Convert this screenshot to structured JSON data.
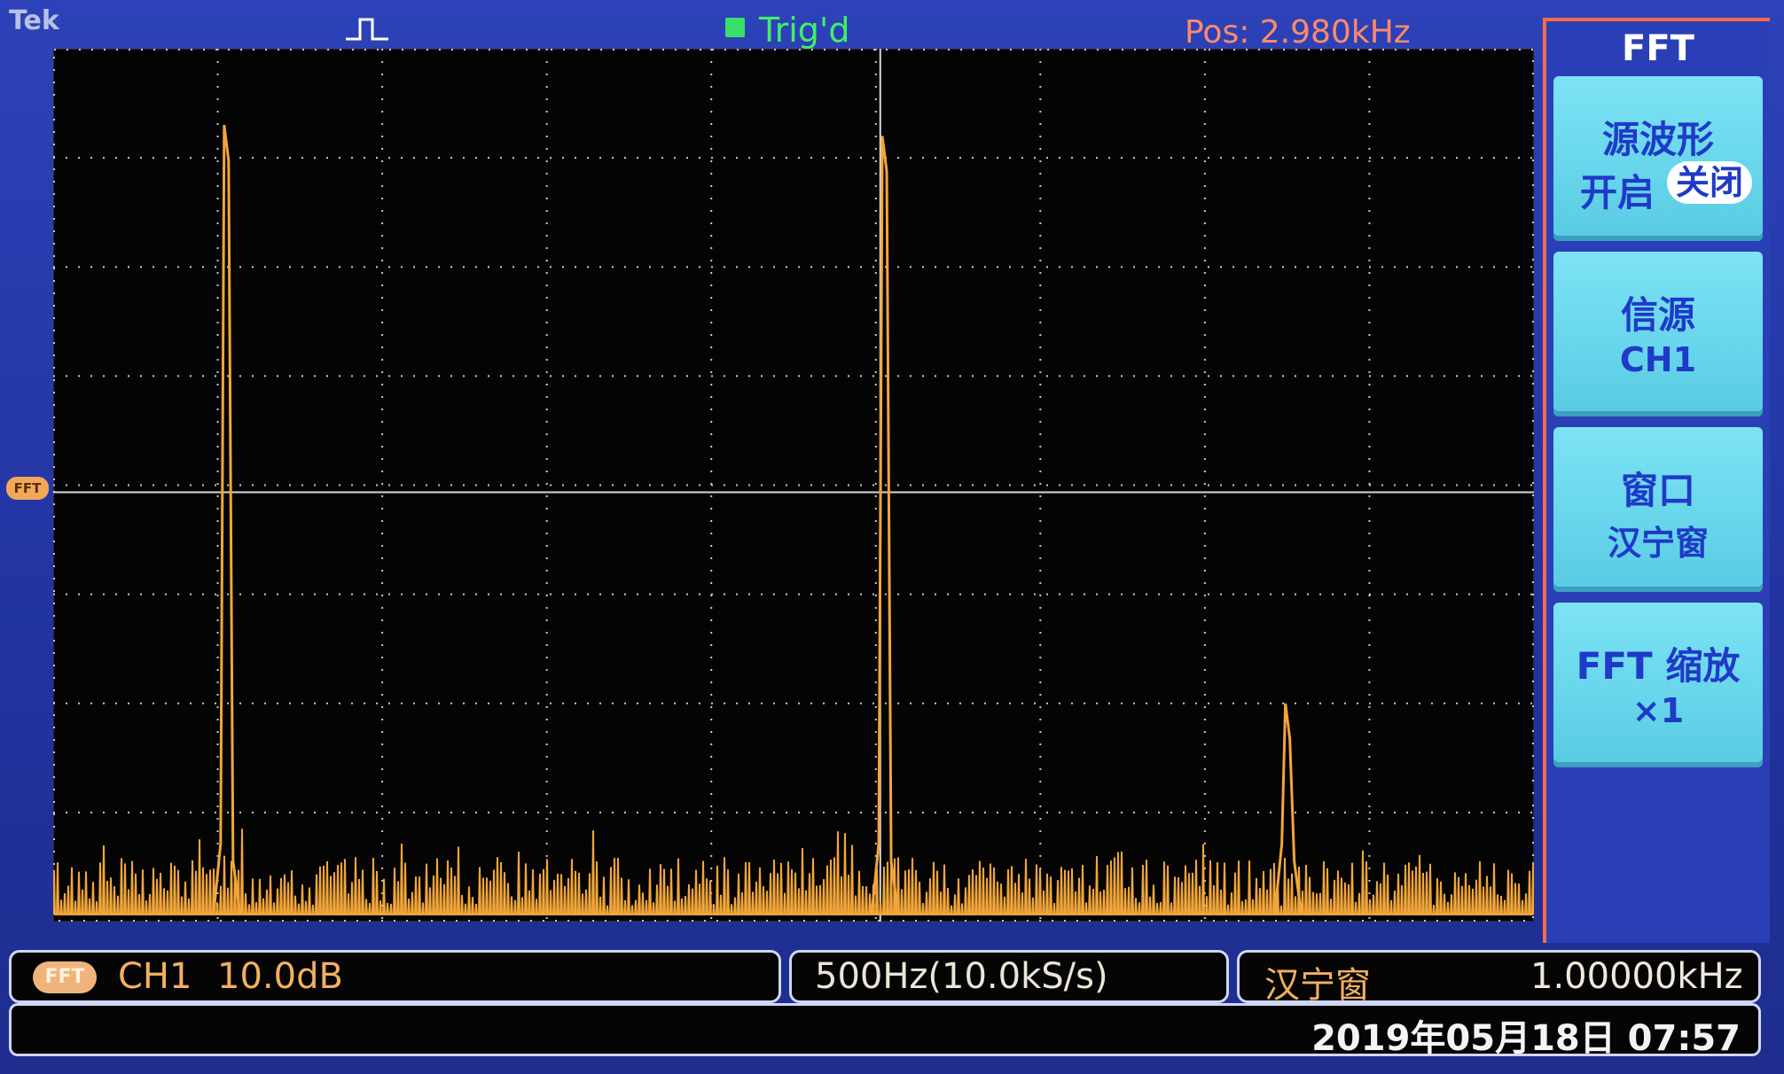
{
  "top": {
    "brand": "Tek",
    "trigger_status": "Trig'd",
    "position": "Pos: 2.980kHz"
  },
  "markers": {
    "fft_level": "FFT"
  },
  "menu": {
    "title": "FFT",
    "items": [
      {
        "line1": "源波形",
        "on_label": "开启",
        "off_label": "关闭",
        "selected": "关闭"
      },
      {
        "line1": "信源",
        "line2": "CH1"
      },
      {
        "line1": "窗口",
        "line2": "汉宁窗"
      },
      {
        "line1": "FFT 缩放",
        "line2": "×1"
      }
    ]
  },
  "status": {
    "channel_badge": "FFT",
    "channel": "CH1",
    "scale": "10.0dB",
    "timebase": "500Hz(10.0kS/s)",
    "window": "汉宁窗",
    "frequency": "1.00000kHz"
  },
  "datetime": "2019年05月18日 07:57",
  "colors": {
    "trace": "#f2a63a",
    "graticule_dots": "#c9c9c9",
    "trigger_green": "#43ee6a",
    "menu_button": "#63d2ea",
    "accent_orange": "#ff8a6a"
  },
  "spectrum": {
    "major_peaks": [
      {
        "label": "",
        "x_division": 1.05,
        "level_division": 7.3
      },
      {
        "label": "",
        "x_division": 5.05,
        "level_division": 7.2
      },
      {
        "label": "",
        "x_division": 7.5,
        "level_division": 2.0
      }
    ]
  }
}
